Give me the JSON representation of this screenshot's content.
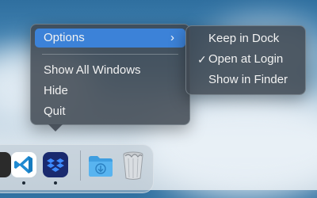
{
  "context_menu": {
    "items": [
      {
        "label": "Options",
        "has_submenu": true,
        "highlighted": true
      },
      {
        "label": "Show All Windows"
      },
      {
        "label": "Hide"
      },
      {
        "label": "Quit"
      }
    ],
    "submenu_chevron": "›"
  },
  "options_submenu": {
    "items": [
      {
        "label": "Keep in Dock",
        "checked": false
      },
      {
        "label": "Open at Login",
        "checked": true
      },
      {
        "label": "Show in Finder",
        "checked": false
      }
    ],
    "check_mark": "✓"
  },
  "dock": {
    "apps": [
      {
        "icon": "app-icon-partial",
        "running": false
      },
      {
        "icon": "vscode-icon",
        "running": true
      },
      {
        "icon": "dropbox-icon",
        "running": true
      },
      {
        "icon": "downloads-folder-icon",
        "running": false
      },
      {
        "icon": "trash-icon",
        "running": false
      }
    ]
  },
  "colors": {
    "highlight": "#3c82d8",
    "menu_bg": "#404852",
    "vscode_blue": "#1f8ad2",
    "dropbox_bg": "#1a2a6e",
    "folder_blue": "#58b4f0"
  }
}
